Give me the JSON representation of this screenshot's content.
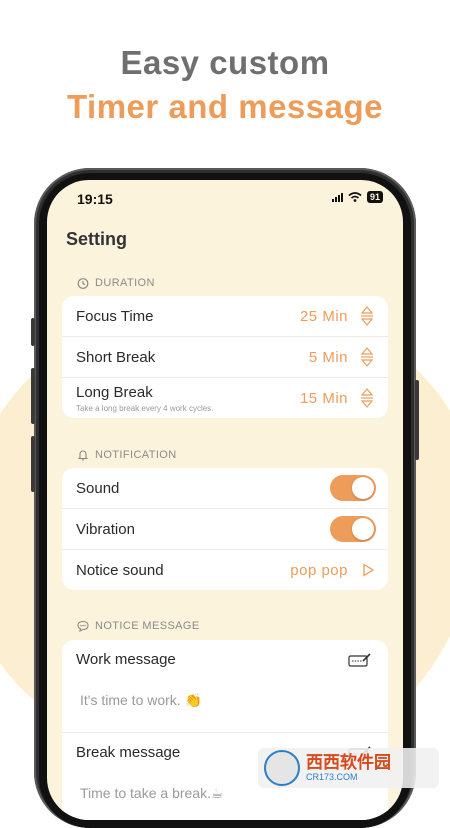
{
  "headline": {
    "line1": "Easy custom",
    "line2": "Timer and message"
  },
  "status_bar": {
    "time": "19:15",
    "battery": "91"
  },
  "page_title": "Setting",
  "duration": {
    "header": "DURATION",
    "items": [
      {
        "label": "Focus Time",
        "value": "25  Min"
      },
      {
        "label": "Short Break",
        "value": "5  Min"
      },
      {
        "label": "Long Break",
        "value": "15  Min",
        "hint": "Take a long break every 4 work cycles."
      }
    ]
  },
  "notification": {
    "header": "NOTIFICATION",
    "sound_label": "Sound",
    "sound_on": true,
    "vibration_label": "Vibration",
    "vibration_on": true,
    "notice_sound_label": "Notice sound",
    "notice_sound_value": "pop pop"
  },
  "notice_message": {
    "header": "NOTICE MESSAGE",
    "work_label": "Work message",
    "work_text": "It's time to work. 👏",
    "break_label": "Break message",
    "break_text": "Time to take a break.☕"
  },
  "watermark": {
    "name": "西西软件园",
    "url": "CR173.COM"
  },
  "colors": {
    "accent": "#ee9c59",
    "screen_bg": "#fcf3dc",
    "headline_gray": "#6f6f6f"
  }
}
